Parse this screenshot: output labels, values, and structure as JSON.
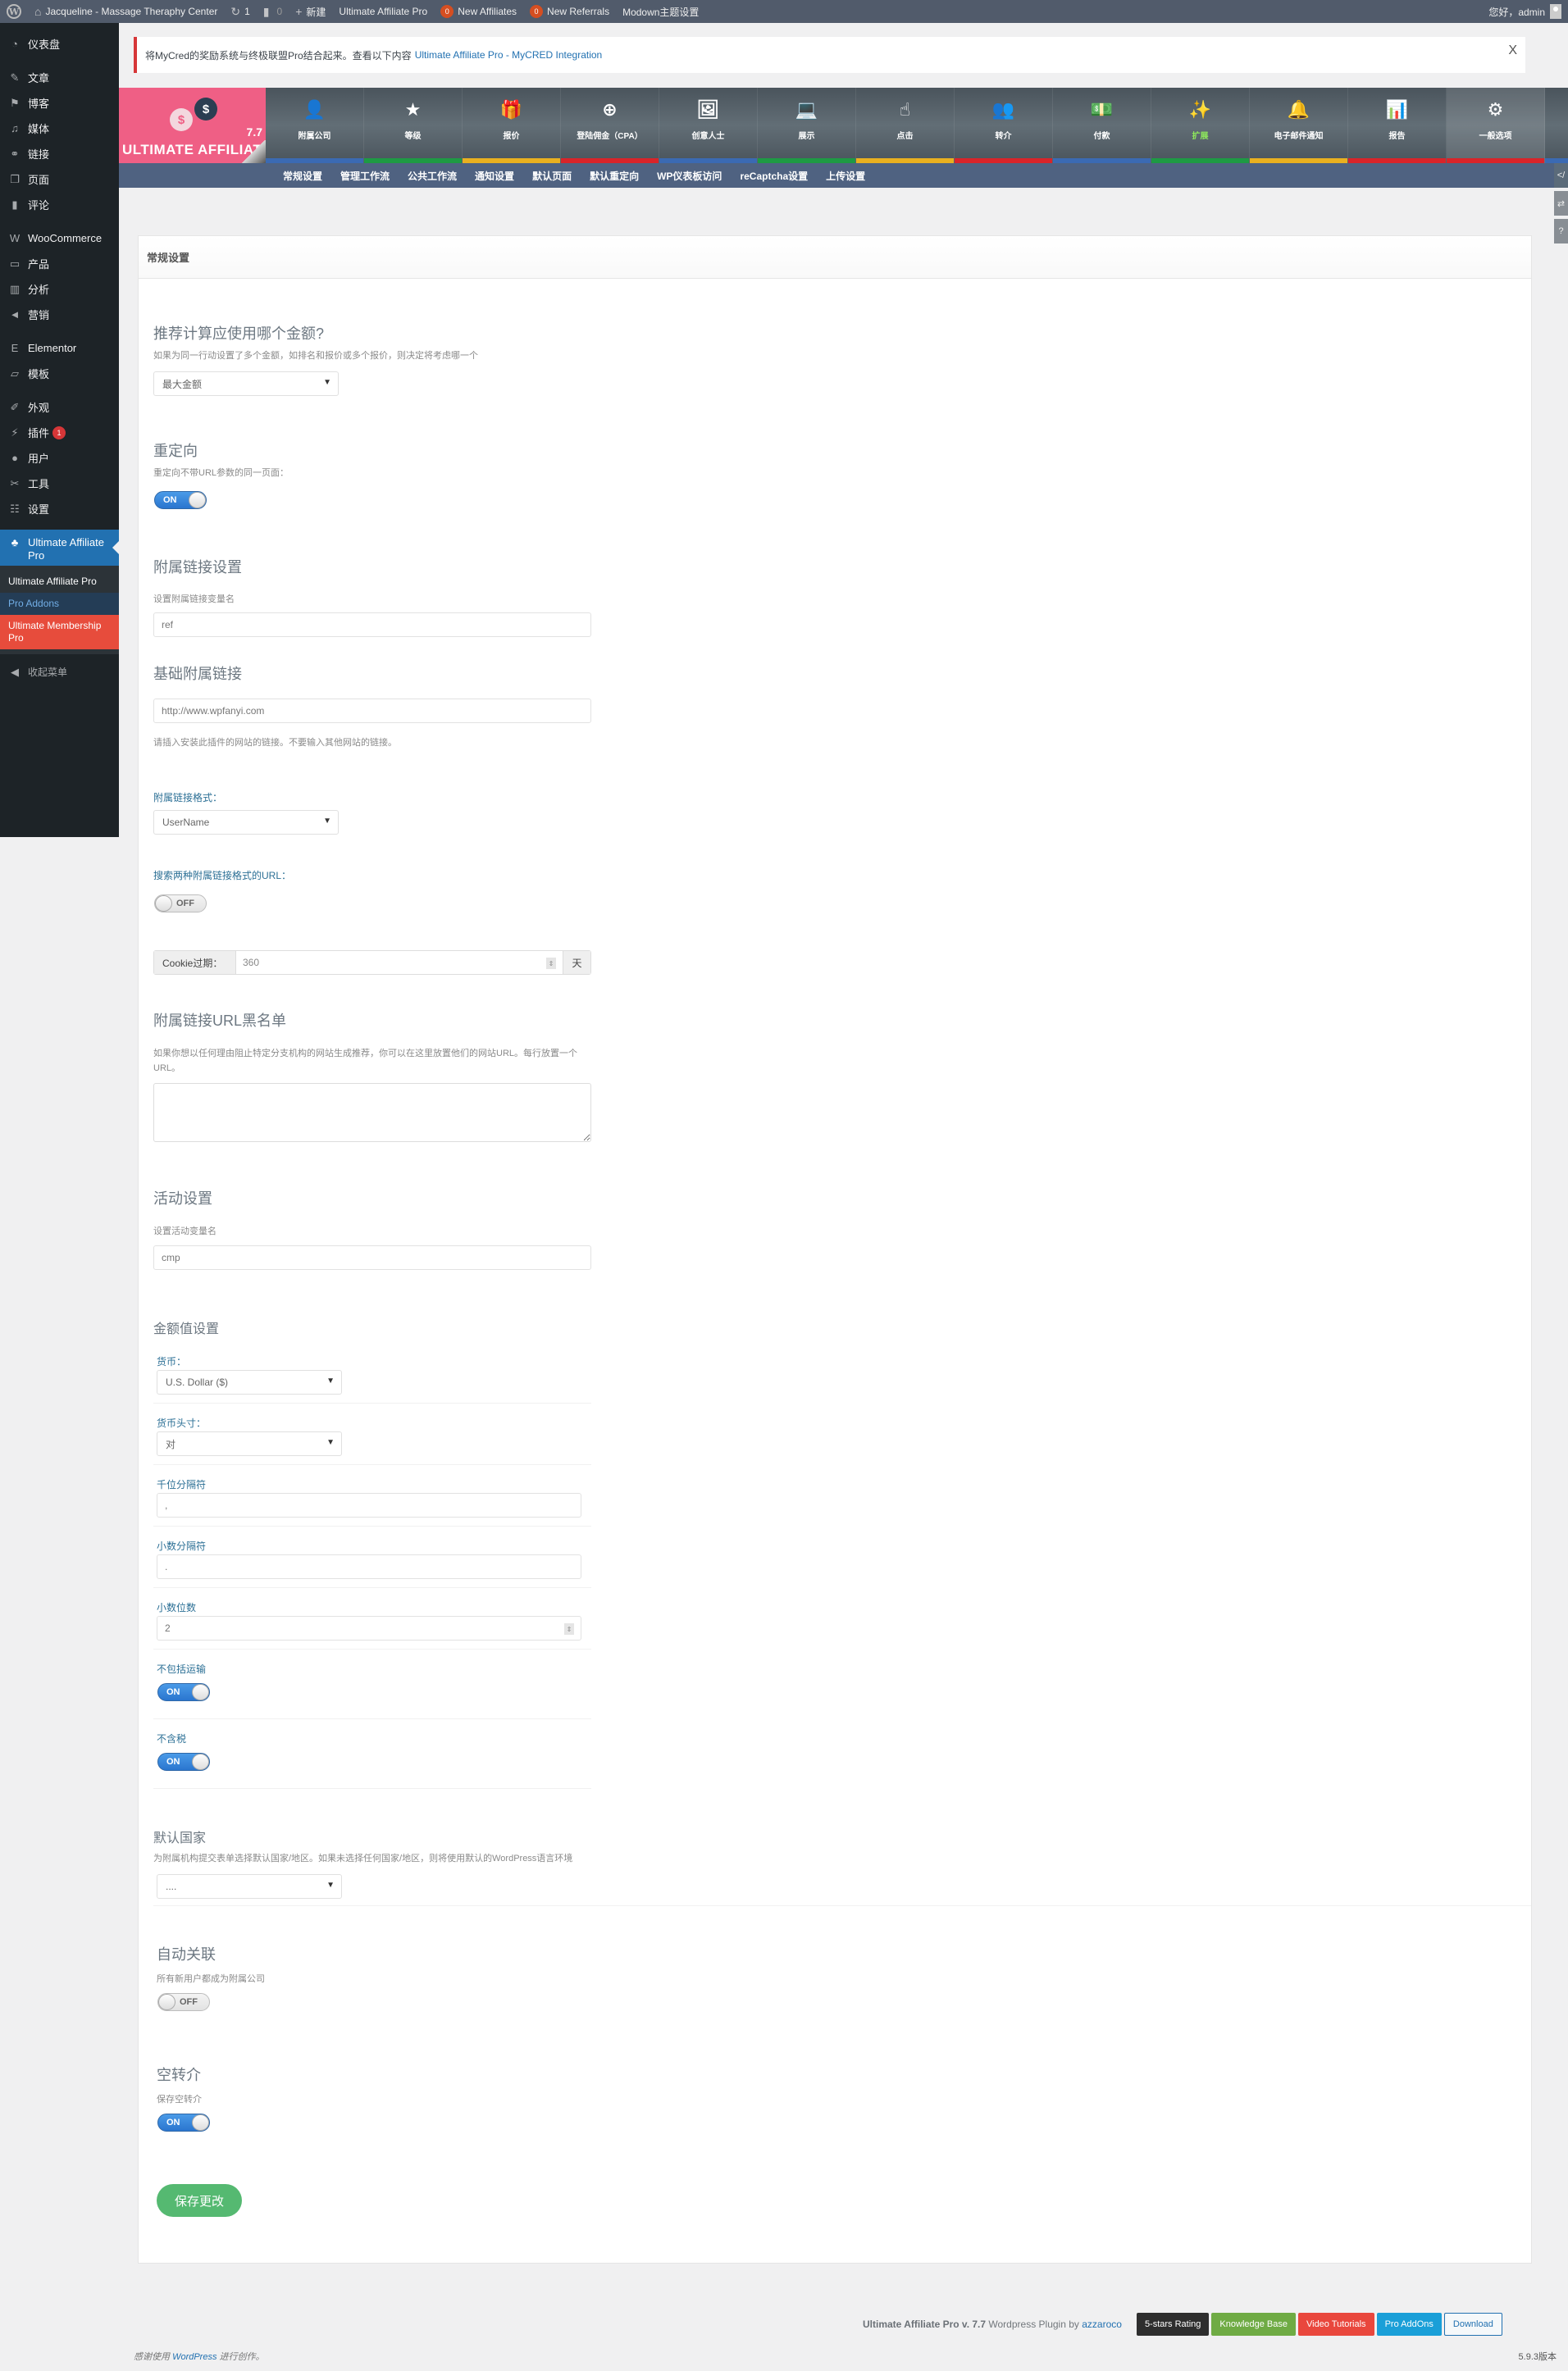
{
  "adminbar": {
    "wp_logo": "wordpress-icon",
    "site_name": "Jacqueline - Massage Theraphy Center",
    "updates_count": "1",
    "comments_count": "0",
    "new_label": "新建",
    "uap_label": "Ultimate Affiliate Pro",
    "new_affiliates_count": "0",
    "new_affiliates_label": "New Affiliates",
    "new_referrals_count": "0",
    "new_referrals_label": "New Referrals",
    "modown_label": "Modown主题设置",
    "greeting": "您好，admin"
  },
  "sidebar": {
    "items": [
      {
        "label": "仪表盘",
        "icon": "dashboard-icon",
        "glyph": "◔"
      },
      {
        "label": "文章",
        "icon": "pin-icon",
        "glyph": "✎"
      },
      {
        "label": "博客",
        "icon": "flag-icon",
        "glyph": "⚑"
      },
      {
        "label": "媒体",
        "icon": "media-icon",
        "glyph": "♫"
      },
      {
        "label": "链接",
        "icon": "link-icon",
        "glyph": "⚭"
      },
      {
        "label": "页面",
        "icon": "page-icon",
        "glyph": "❐"
      },
      {
        "label": "评论",
        "icon": "comment-icon",
        "glyph": "▮"
      },
      {
        "label": "WooCommerce",
        "icon": "woocommerce-icon",
        "glyph": "W"
      },
      {
        "label": "产品",
        "icon": "archive-icon",
        "glyph": "▭"
      },
      {
        "label": "分析",
        "icon": "bar-chart-icon",
        "glyph": "▥"
      },
      {
        "label": "营销",
        "icon": "megaphone-icon",
        "glyph": "◄"
      },
      {
        "label": "Elementor",
        "icon": "elementor-icon",
        "glyph": "E"
      },
      {
        "label": "模板",
        "icon": "folder-icon",
        "glyph": "▱"
      },
      {
        "label": "外观",
        "icon": "brush-icon",
        "glyph": "✐"
      },
      {
        "label": "插件",
        "icon": "plugin-icon",
        "glyph": "⚡",
        "badge": "1"
      },
      {
        "label": "用户",
        "icon": "user-icon",
        "glyph": "●"
      },
      {
        "label": "工具",
        "icon": "wrench-icon",
        "glyph": "✂"
      },
      {
        "label": "设置",
        "icon": "settings-icon",
        "glyph": "☷"
      }
    ],
    "active": {
      "label": "Ultimate Affiliate Pro",
      "icon": "sitemap-icon",
      "glyph": "♣"
    },
    "submenu": [
      "Ultimate Affiliate Pro",
      "Pro Addons",
      "Ultimate Membership Pro"
    ],
    "collapse": "收起菜单"
  },
  "notice": {
    "text": "将MyCred的奖励系统与终极联盟Pro结合起来。查看以下内容",
    "link": "Ultimate Affiliate Pro - MyCRED Integration",
    "close": "X"
  },
  "plugin_header": {
    "version": "7.7",
    "brand": "ULTIMATE AFFILIATE",
    "tabs": [
      {
        "label": "附属公司",
        "icon": "user-icon",
        "glyph": "👤",
        "bar": "#3b6ab3"
      },
      {
        "label": "等级",
        "icon": "star-icon",
        "glyph": "★",
        "bar": "#1e9a44"
      },
      {
        "label": "报价",
        "icon": "gift-icon",
        "glyph": "🎁",
        "bar": "#e9b020"
      },
      {
        "label": "登陆佣金（CPA）",
        "icon": "plus-circle-icon",
        "glyph": "⊕",
        "bar": "#d9242a"
      },
      {
        "label": "创意人士",
        "icon": "image-icon",
        "glyph": "🖼",
        "bar": "#3b6ab3"
      },
      {
        "label": "展示",
        "icon": "laptop-icon",
        "glyph": "💻",
        "bar": "#1e9a44"
      },
      {
        "label": "点击",
        "icon": "pointer-hand-icon",
        "glyph": "☝",
        "bar": "#e9b020"
      },
      {
        "label": "转介",
        "icon": "users-icon",
        "glyph": "👥",
        "bar": "#d9242a"
      },
      {
        "label": "付款",
        "icon": "money-icon",
        "glyph": "💵",
        "bar": "#3b6ab3"
      },
      {
        "label": "扩展",
        "icon": "magic-wand-icon",
        "glyph": "✨",
        "bar": "#1e9a44",
        "green": true
      },
      {
        "label": "电子邮件通知",
        "icon": "bell-icon",
        "glyph": "🔔",
        "bar": "#e9b020"
      },
      {
        "label": "报告",
        "icon": "bar-chart-icon",
        "glyph": "📊",
        "bar": "#d9242a"
      },
      {
        "label": "一般选项",
        "icon": "gear-icon",
        "glyph": "⚙",
        "bar": "#d9242a",
        "active": true
      }
    ],
    "subtabs": [
      "常规设置",
      "管理工作流",
      "公共工作流",
      "通知设置",
      "默认页面",
      "默认重定向",
      "WP仪表板访问",
      "reCaptcha设置",
      "上传设置"
    ],
    "right_tools": [
      {
        "icon": "code-icon",
        "glyph": "</"
      },
      {
        "icon": "swap-icon",
        "glyph": "⇄"
      },
      {
        "icon": "help-icon",
        "glyph": "?"
      }
    ]
  },
  "panel": {
    "title": "常规设置",
    "amount": {
      "heading": "推荐计算应使用哪个金额?",
      "desc": "如果为同一行动设置了多个金额，如排名和报价或多个报价，则决定将考虑哪一个",
      "value": "最大金额"
    },
    "redirect": {
      "heading": "重定向",
      "desc": "重定向不带URL参数的同一页面：",
      "toggle": "ON"
    },
    "link_settings": {
      "heading": "附属链接设置",
      "var_label": "设置附属链接变量名",
      "var_value": "ref"
    },
    "base_link": {
      "heading": "基础附属链接",
      "value": "http://www.wpfanyi.com",
      "help": "请插入安装此插件的网站的链接。不要输入其他网站的链接。"
    },
    "link_format": {
      "label": "附属链接格式：",
      "value": "UserName"
    },
    "search_both": {
      "label": "搜索两种附属链接格式的URL：",
      "toggle": "OFF"
    },
    "cookie": {
      "label": "Cookie过期：",
      "value": "360",
      "unit": "天"
    },
    "blacklist": {
      "heading": "附属链接URL黑名单",
      "desc": "如果你想以任何理由阻止特定分支机构的网站生成推荐，你可以在这里放置他们的网站URL。每行放置一个URL。",
      "value": ""
    },
    "campaign": {
      "heading": "活动设置",
      "var_label": "设置活动变量名",
      "var_value": "cmp"
    },
    "amount_value": {
      "heading": "金额值设置",
      "currency_label": "货币：",
      "currency_value": "U.S. Dollar ($)",
      "position_label": "货币头寸：",
      "position_value": "对",
      "thousands_label": "千位分隔符",
      "thousands_value": ",",
      "decimal_label": "小数分隔符",
      "decimal_value": ".",
      "decimals_label": "小数位数",
      "decimals_value": "2",
      "shipping_label": "不包括运输",
      "shipping_toggle": "ON",
      "tax_label": "不含税",
      "tax_toggle": "ON"
    },
    "country": {
      "heading": "默认国家",
      "desc": "为附属机构提交表单选择默认国家/地区。如果未选择任何国家/地区，则将使用默认的WordPress语言环境",
      "value": "...."
    },
    "auto_affiliate": {
      "heading": "自动关联",
      "desc": "所有新用户都成为附属公司",
      "toggle": "OFF"
    },
    "empty_referrals": {
      "heading": "空转介",
      "desc": "保存空转介",
      "toggle": "ON"
    },
    "save": "保存更改"
  },
  "footer": {
    "plugin_name": "Ultimate Affiliate Pro v. 7.7",
    "plugin_by": "Wordpress Plugin by",
    "author": "azzaroco",
    "buttons": [
      {
        "label": "5-stars Rating",
        "color": "#2e2e2e"
      },
      {
        "label": "Knowledge Base",
        "color": "#6fab44"
      },
      {
        "label": "Video Tutorials",
        "color": "#e9473d"
      },
      {
        "label": "Pro AddOns",
        "color": "#1a9fd8"
      },
      {
        "label": "Download",
        "color": "#f5f8fa"
      }
    ],
    "thanks_prefix": "感谢使用",
    "thanks_link": "WordPress",
    "thanks_suffix": "进行创作。",
    "version": "5.9.3版本"
  }
}
